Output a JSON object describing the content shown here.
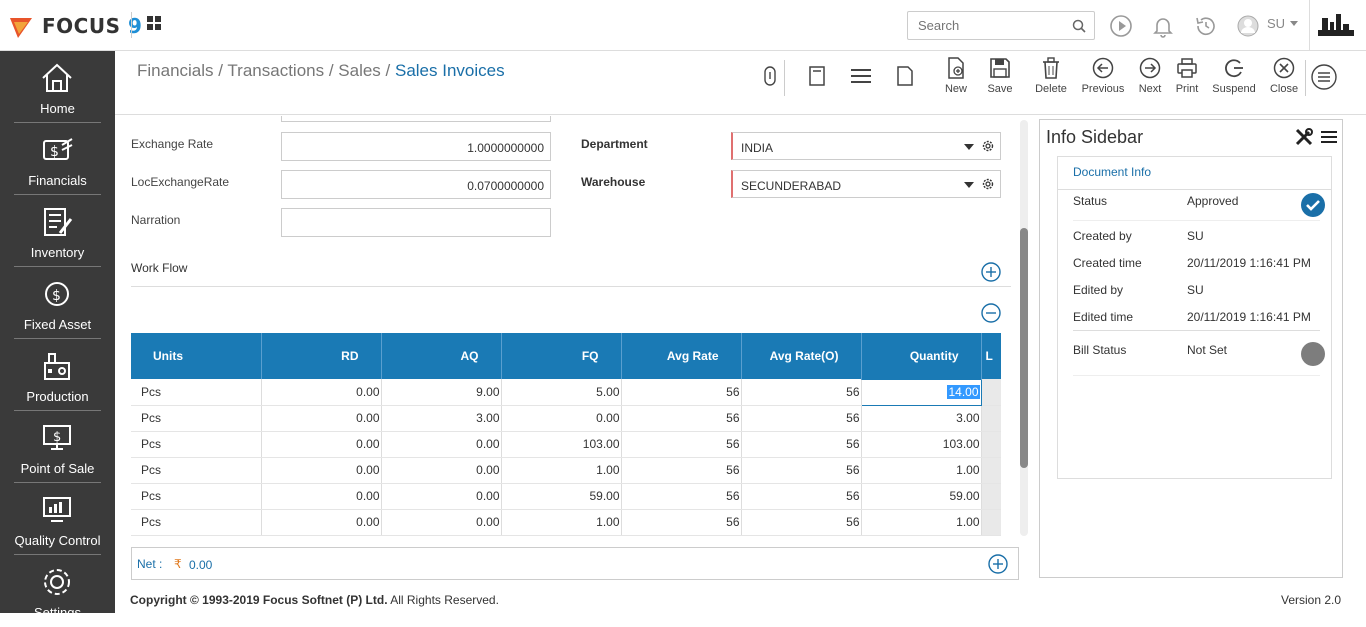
{
  "app": {
    "logo_text": "FOCUS",
    "logo_num": "9"
  },
  "topbar": {
    "search_placeholder": "Search",
    "user": "SU"
  },
  "sidebar": {
    "items": [
      {
        "label": "Home",
        "icon": "home-icon"
      },
      {
        "label": "Financials",
        "icon": "financials-icon"
      },
      {
        "label": "Inventory",
        "icon": "inventory-icon"
      },
      {
        "label": "Fixed Asset",
        "icon": "fixed-asset-icon"
      },
      {
        "label": "Production",
        "icon": "production-icon"
      },
      {
        "label": "Point of Sale",
        "icon": "point-of-sale-icon"
      },
      {
        "label": "Quality Control",
        "icon": "quality-control-icon"
      },
      {
        "label": "Settings",
        "icon": "settings-icon"
      }
    ]
  },
  "breadcrumb": {
    "p1": "Financials",
    "p2": "Transactions",
    "p3": "Sales",
    "current": "Sales Invoices",
    "sep": " / "
  },
  "toolbar": {
    "new": "New",
    "save": "Save",
    "delete": "Delete",
    "previous": "Previous",
    "next": "Next",
    "print": "Print",
    "suspend": "Suspend",
    "close": "Close"
  },
  "form": {
    "exchange_rate_label": "Exchange Rate",
    "exchange_rate_value": "1.0000000000",
    "loc_exchange_rate_label": "LocExchangeRate",
    "loc_exchange_rate_value": "0.0700000000",
    "narration_label": "Narration",
    "narration_value": "",
    "department_label": "Department",
    "department_value": "INDIA",
    "warehouse_label": "Warehouse",
    "warehouse_value": "SECUNDERABAD",
    "workflow_label": "Work Flow"
  },
  "grid": {
    "columns": [
      "Units",
      "RD",
      "AQ",
      "FQ",
      "Avg Rate",
      "Avg Rate(O)",
      "Quantity",
      "L"
    ],
    "rows": [
      [
        "Pcs",
        "0.00",
        "9.00",
        "5.00",
        "56",
        "56",
        "14.00"
      ],
      [
        "Pcs",
        "0.00",
        "3.00",
        "0.00",
        "56",
        "56",
        "3.00"
      ],
      [
        "Pcs",
        "0.00",
        "0.00",
        "103.00",
        "56",
        "56",
        "103.00"
      ],
      [
        "Pcs",
        "0.00",
        "0.00",
        "1.00",
        "56",
        "56",
        "1.00"
      ],
      [
        "Pcs",
        "0.00",
        "0.00",
        "59.00",
        "56",
        "56",
        "59.00"
      ],
      [
        "Pcs",
        "0.00",
        "0.00",
        "1.00",
        "56",
        "56",
        "1.00"
      ]
    ]
  },
  "net": {
    "label": "Net :",
    "currency": "₹",
    "value": "0.00"
  },
  "info": {
    "title": "Info Sidebar",
    "tab": "Document Info",
    "status_label": "Status",
    "status_value": "Approved",
    "created_by_label": "Created by",
    "created_by_value": "SU",
    "created_time_label": "Created time",
    "created_time_value": "20/11/2019 1:16:41 PM",
    "edited_by_label": "Edited by",
    "edited_by_value": "SU",
    "edited_time_label": "Edited time",
    "edited_time_value": "20/11/2019 1:16:41 PM",
    "bill_status_label": "Bill Status",
    "bill_status_value": "Not Set"
  },
  "footer": {
    "copyright_bold": "Copyright © 1993-2019 Focus Softnet (P) Ltd.",
    "copyright_rest": " All Rights Reserved.",
    "version": "Version 2.0"
  },
  "colors": {
    "accent": "#1a7ab5",
    "sidebar": "#3a3a3a",
    "approved": "#1a6fa8"
  }
}
